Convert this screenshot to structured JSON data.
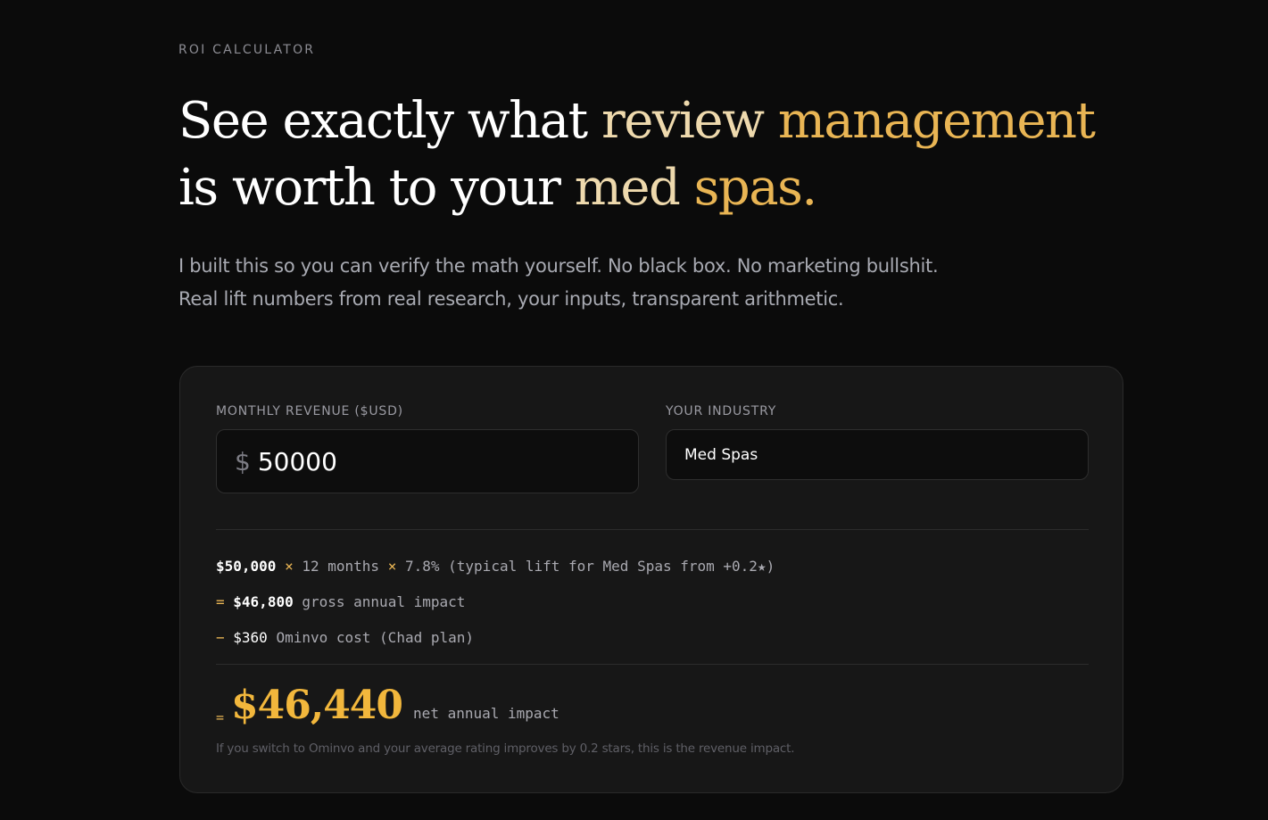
{
  "eyebrow": "ROI CALCULATOR",
  "headline": {
    "line1_plain": "See exactly what ",
    "line1_accent_light": "review ",
    "line1_accent": "management",
    "line2_plain": "is worth to your ",
    "line2_accent_light": "med ",
    "line2_accent": "spas."
  },
  "subtitle": {
    "line1": "I built this so you can verify the math yourself. No black box. No marketing bullshit.",
    "line2": "Real lift numbers from real research, your inputs, transparent arithmetic."
  },
  "calculator": {
    "revenue_label": "MONTHLY REVENUE ($USD)",
    "currency_symbol": "$",
    "revenue_value": "50000",
    "industry_label": "YOUR INDUSTRY",
    "industry_value": "Med Spas",
    "breakdown": {
      "revenue": "$50,000",
      "times1": "×",
      "months": "12 months",
      "times2": "×",
      "lift": "7.8% (typical lift for Med Spas from +0.2★)",
      "eq1": "=",
      "gross": "$46,800",
      "gross_label": "gross annual impact",
      "minus": "−",
      "cost": "$360",
      "cost_label": "Ominvo cost (Chad plan)"
    },
    "net": {
      "eq": "=",
      "value": "$46,440",
      "label": "net annual impact"
    },
    "footnote": "If you switch to Ominvo and your average rating improves by 0.2 stars, this is the revenue impact."
  },
  "colors": {
    "background": "#0b0b0b",
    "card": "#171717",
    "accent_gold": "#e9b554",
    "accent_gold_light": "#eed9ad"
  }
}
